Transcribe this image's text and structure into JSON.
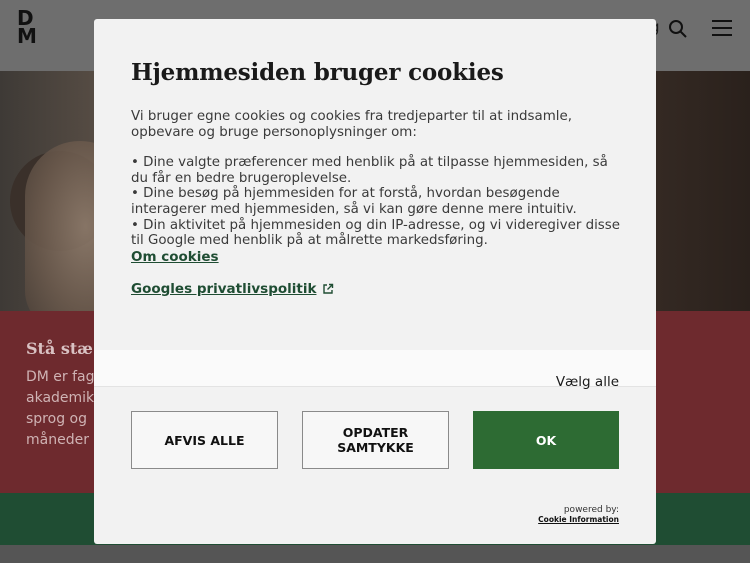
{
  "header": {
    "logo": "DM",
    "partial_text": "g"
  },
  "background": {
    "red_title": "Stå stæ",
    "red_lines": [
      "DM er fag",
      "akademik",
      "sprog og",
      "måneder o"
    ]
  },
  "modal": {
    "title": "Hjemmesiden bruger cookies",
    "intro": "Vi bruger egne cookies og cookies fra tredjeparter til at indsamle, opbevare og bruge personoplysninger om:",
    "bullets": [
      "• Dine valgte præferencer med henblik på at tilpasse hjemmesiden, så du får en bedre brugeroplevelse.",
      "• Dine besøg på hjemmesiden for at forstå, hvordan besøgende interagerer med hjemmesiden, så vi kan gøre denne mere intuitiv.",
      "• Din aktivitet på hjemmesiden og din IP-adresse, og vi videregiver disse til Google med henblik på at målrette markedsføring."
    ],
    "link_cookies": "Om cookies",
    "link_google": "Googles privatlivspolitik",
    "select_all": "Vælg alle",
    "buttons": {
      "reject": "AFVIS ALLE",
      "update_line1": "OPDATER",
      "update_line2": "SAMTYKKE",
      "ok": "OK"
    },
    "powered_by": "powered by:",
    "powered_name": "Cookie Information"
  },
  "colors": {
    "accent_green": "#2d6b33",
    "link_green": "#1f4d33",
    "bg_red": "#6e2a2e"
  }
}
